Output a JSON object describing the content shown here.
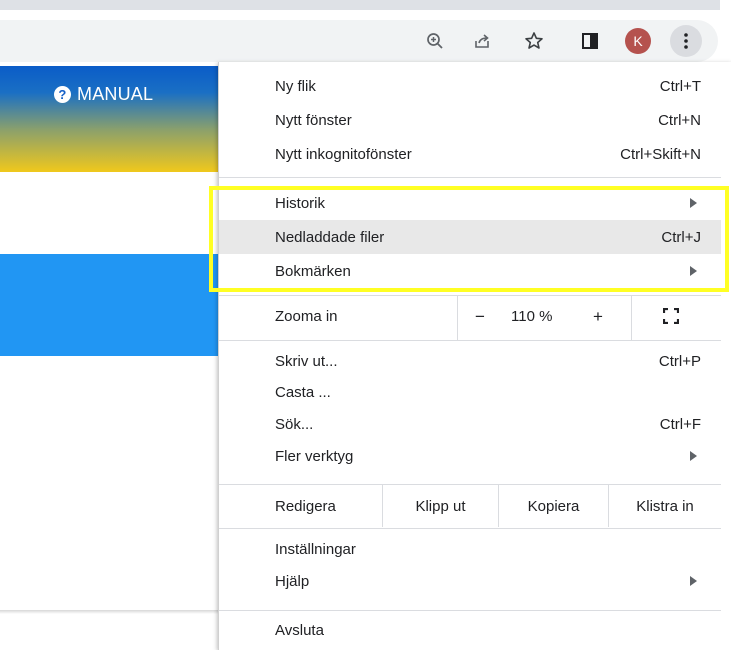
{
  "toolbar": {
    "icons": [
      "zoom-icon",
      "share-icon",
      "bookmark-star-icon",
      "side-panel-icon"
    ],
    "avatar_letter": "K"
  },
  "page": {
    "manual_label": "MANUAL"
  },
  "menu": {
    "new_tab": {
      "label": "Ny flik",
      "shortcut": "Ctrl+T"
    },
    "new_window": {
      "label": "Nytt fönster",
      "shortcut": "Ctrl+N"
    },
    "new_incognito": {
      "label": "Nytt inkognitofönster",
      "shortcut": "Ctrl+Skift+N"
    },
    "history": {
      "label": "Historik"
    },
    "downloads": {
      "label": "Nedladdade filer",
      "shortcut": "Ctrl+J"
    },
    "bookmarks": {
      "label": "Bokmärken"
    },
    "zoom": {
      "label": "Zooma in",
      "minus": "−",
      "value": "110 %",
      "plus": "+"
    },
    "print": {
      "label": "Skriv ut...",
      "shortcut": "Ctrl+P"
    },
    "cast": {
      "label": "Casta ..."
    },
    "find": {
      "label": "Sök...",
      "shortcut": "Ctrl+F"
    },
    "more_tools": {
      "label": "Fler verktyg"
    },
    "edit": {
      "label": "Redigera",
      "cut": "Klipp ut",
      "copy": "Kopiera",
      "paste": "Klistra in"
    },
    "settings": {
      "label": "Inställningar"
    },
    "help": {
      "label": "Hjälp"
    },
    "exit": {
      "label": "Avsluta"
    }
  },
  "colors": {
    "highlight_border": "#ffff24",
    "hover_row": "#e8e8e8",
    "banner_blue": "#0a5cc8",
    "banner_yellow": "#f0c81c",
    "box_blue": "#2196f3"
  }
}
